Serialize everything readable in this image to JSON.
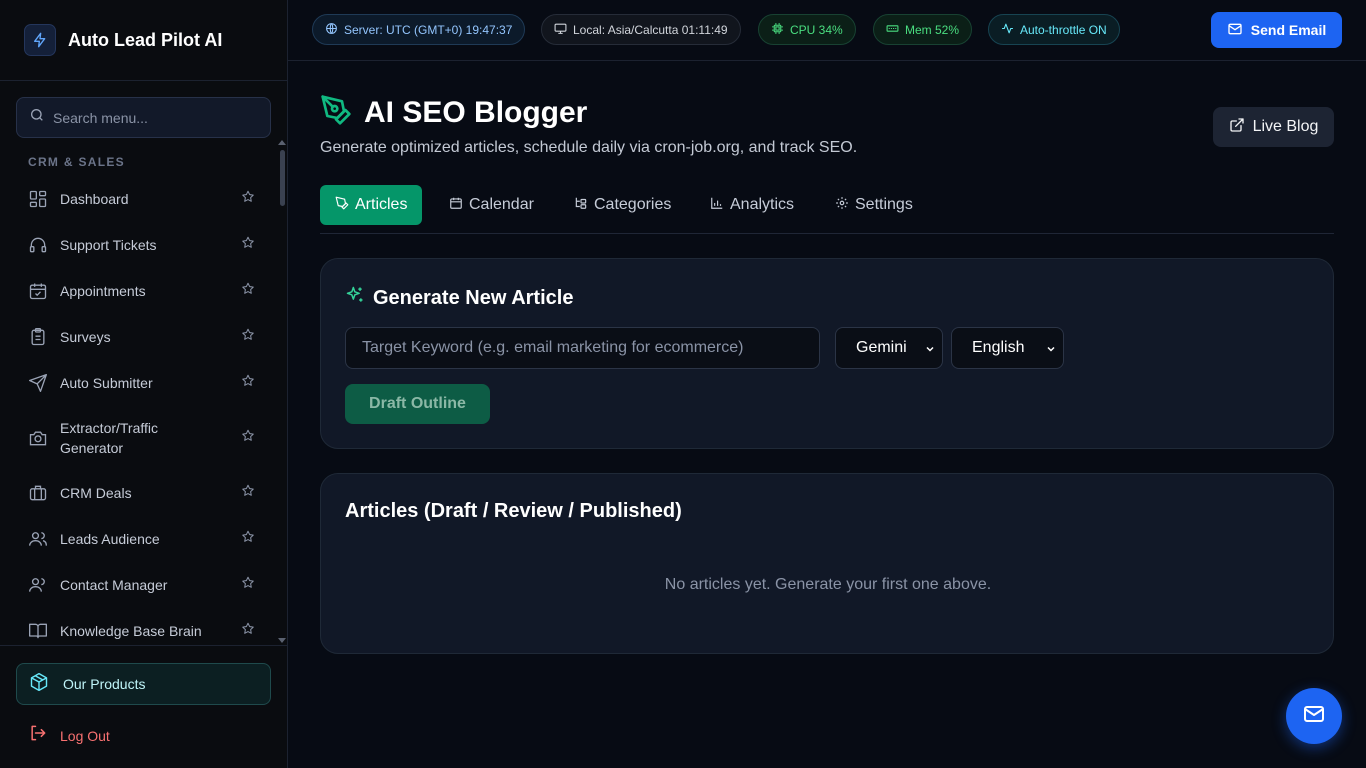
{
  "app": {
    "title": "Auto Lead Pilot AI"
  },
  "sidebar": {
    "search_placeholder": "Search menu...",
    "section_label": "CRM & SALES",
    "items": [
      {
        "label": "Dashboard",
        "icon": "dashboard-icon"
      },
      {
        "label": "Support Tickets",
        "icon": "headset-icon"
      },
      {
        "label": "Appointments",
        "icon": "calendar-check-icon"
      },
      {
        "label": "Surveys",
        "icon": "clipboard-icon"
      },
      {
        "label": "Auto Submitter",
        "icon": "send-icon"
      },
      {
        "label": "Extractor/Traffic Generator",
        "icon": "camera-icon"
      },
      {
        "label": "CRM Deals",
        "icon": "briefcase-icon"
      },
      {
        "label": "Leads Audience",
        "icon": "users-icon"
      },
      {
        "label": "Contact Manager",
        "icon": "contacts-icon"
      },
      {
        "label": "Knowledge Base Brain",
        "icon": "book-icon"
      }
    ],
    "products_label": "Our Products",
    "logout_label": "Log Out"
  },
  "topbar": {
    "server": "Server: UTC (GMT+0) 19:47:37",
    "local": "Local: Asia/Calcutta 01:11:49",
    "cpu": "CPU 34%",
    "mem": "Mem 52%",
    "throttle": "Auto-throttle ON",
    "send_email": "Send Email"
  },
  "page": {
    "title": "AI SEO Blogger",
    "subtitle": "Generate optimized articles, schedule daily via cron-job.org, and track SEO.",
    "live_blog": "Live Blog",
    "tabs": [
      {
        "label": "Articles",
        "active": true
      },
      {
        "label": "Calendar",
        "active": false
      },
      {
        "label": "Categories",
        "active": false
      },
      {
        "label": "Analytics",
        "active": false
      },
      {
        "label": "Settings",
        "active": false
      }
    ]
  },
  "generator": {
    "title": "Generate New Article",
    "keyword_placeholder": "Target Keyword (e.g. email marketing for ecommerce)",
    "model_selected": "Gemini",
    "language_selected": "English",
    "draft_button": "Draft Outline"
  },
  "articles": {
    "title": "Articles (Draft / Review / Published)",
    "empty_message": "No articles yet. Generate your first one above."
  },
  "colors": {
    "accent_green": "#059669",
    "primary_blue": "#1d64f2",
    "background": "#070b14",
    "logout_red": "#f87171"
  }
}
